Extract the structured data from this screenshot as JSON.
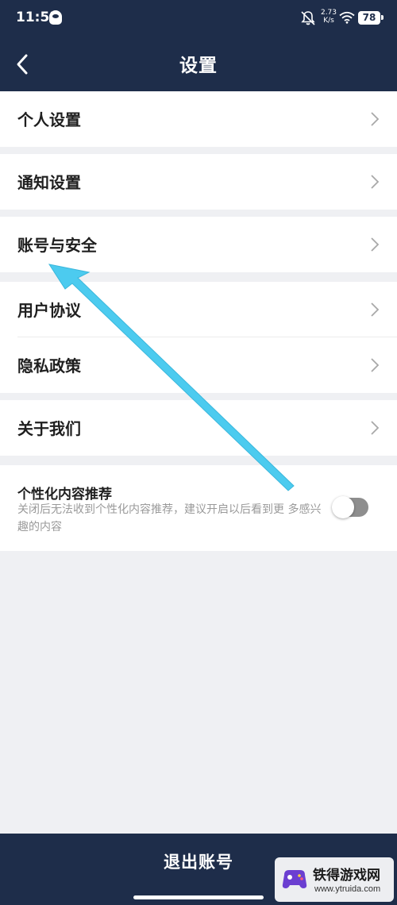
{
  "status_bar": {
    "time": "11:53",
    "net_speed_value": "2.73",
    "net_speed_unit": "K/s",
    "battery": "78",
    "icons": [
      "qq-icon",
      "bell-off-icon",
      "wifi-icon",
      "battery-icon"
    ]
  },
  "header": {
    "title": "设置",
    "back_icon": "back-arrow-icon"
  },
  "settings": {
    "group1": {
      "item": "个人设置"
    },
    "group2": {
      "item": "通知设置"
    },
    "group3": {
      "item": "账号与安全"
    },
    "group4": {
      "item1": "用户协议",
      "item2": "隐私政策"
    },
    "group5": {
      "item": "关于我们"
    },
    "personalized": {
      "title": "个性化内容推荐",
      "description": "关闭后无法收到个性化内容推荐，建议开启以后看到更 多感兴趣的内容",
      "enabled": false
    }
  },
  "footer": {
    "logout": "退出账号"
  },
  "watermark": {
    "title": "铁得游戏网",
    "url": "www.ytruida.com"
  },
  "colors": {
    "header_bg": "#1e2d4a",
    "page_bg": "#eff0f3",
    "annotation_arrow": "#4ccbef",
    "toggle_off": "#8e8e8e"
  }
}
